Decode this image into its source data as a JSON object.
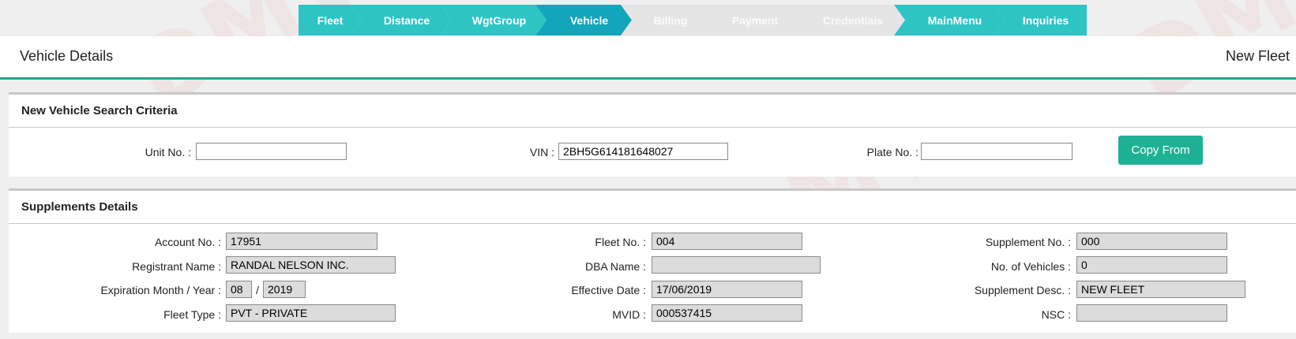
{
  "steps": [
    {
      "label": "Fleet",
      "state": "done"
    },
    {
      "label": "Distance",
      "state": "done"
    },
    {
      "label": "WgtGroup",
      "state": "done"
    },
    {
      "label": "Vehicle",
      "state": "active"
    },
    {
      "label": "Billing",
      "state": "disabled"
    },
    {
      "label": "Payment",
      "state": "disabled"
    },
    {
      "label": "Credentials",
      "state": "disabled"
    },
    {
      "label": "MainMenu",
      "state": "done"
    },
    {
      "label": "Inquiries",
      "state": "done"
    }
  ],
  "header": {
    "title": "Vehicle Details",
    "right": "New Fleet"
  },
  "search": {
    "title": "New Vehicle Search Criteria",
    "unit_label": "Unit No. :",
    "unit_value": "",
    "vin_label": "VIN :",
    "vin_value": "2BH5G614181648027",
    "plate_label": "Plate No. :",
    "plate_value": "",
    "copy_button": "Copy From"
  },
  "supplements": {
    "title": "Supplements Details",
    "account_label": "Account No. :",
    "account_value": "17951",
    "registrant_label": "Registrant Name :",
    "registrant_value": "RANDAL NELSON INC.",
    "expiration_label": "Expiration Month / Year :",
    "exp_month": "08",
    "exp_sep": "/",
    "exp_year": "2019",
    "fleet_type_label": "Fleet Type :",
    "fleet_type_value": "PVT - PRIVATE",
    "fleet_no_label": "Fleet No. :",
    "fleet_no_value": "004",
    "dba_label": "DBA Name :",
    "dba_value": "",
    "effective_label": "Effective Date :",
    "effective_value": "17/06/2019",
    "mvid_label": "MVID :",
    "mvid_value": "000537415",
    "supp_no_label": "Supplement No. :",
    "supp_no_value": "000",
    "num_vehicles_label": "No. of Vehicles :",
    "num_vehicles_value": "0",
    "supp_desc_label": "Supplement Desc. :",
    "supp_desc_value": "NEW FLEET",
    "nsc_label": "NSC :",
    "nsc_value": ""
  },
  "colors": {
    "accent": "#27a292",
    "step_done": "#2ec4c4",
    "step_active": "#13a6bb",
    "step_disabled": "#e5e5e5",
    "button": "#1fb195"
  }
}
